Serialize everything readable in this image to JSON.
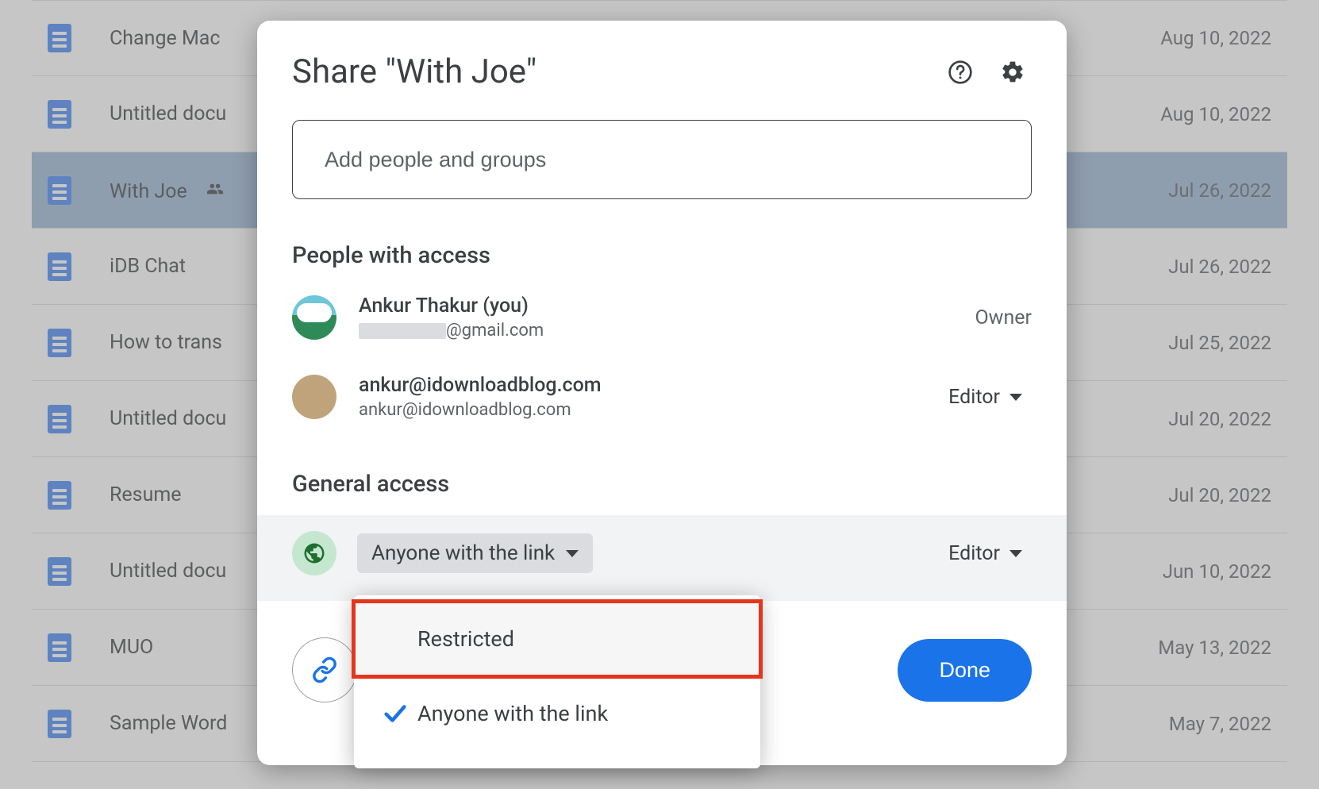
{
  "files": [
    {
      "name": "Change Mac",
      "date": "Aug 10, 2022",
      "shared": false
    },
    {
      "name": "Untitled docu",
      "date": "Aug 10, 2022",
      "shared": false
    },
    {
      "name": "With Joe",
      "date": "Jul 26, 2022",
      "shared": true,
      "selected": true
    },
    {
      "name": "iDB Chat",
      "date": "Jul 26, 2022",
      "shared": false
    },
    {
      "name": "How to trans",
      "date": "Jul 25, 2022",
      "shared": false
    },
    {
      "name": "Untitled docu",
      "date": "Jul 20, 2022",
      "shared": false
    },
    {
      "name": "Resume",
      "date": "Jul 20, 2022",
      "shared": false
    },
    {
      "name": "Untitled docu",
      "date": "Jun 10, 2022",
      "shared": false
    },
    {
      "name": "MUO",
      "date": "May 13, 2022",
      "shared": false
    },
    {
      "name": "Sample Word",
      "date": "May 7, 2022",
      "shared": false
    }
  ],
  "modal": {
    "title": "Share \"With Joe\"",
    "add_placeholder": "Add people and groups",
    "people_heading": "People with access",
    "general_heading": "General access",
    "done": "Done"
  },
  "people": {
    "owner": {
      "name": "Ankur Thakur (you)",
      "email_suffix": "@gmail.com",
      "role": "Owner"
    },
    "editor1": {
      "name": "ankur@idownloadblog.com",
      "email": "ankur@idownloadblog.com",
      "role": "Editor"
    }
  },
  "general": {
    "current": "Anyone with the link",
    "role": "Editor"
  },
  "dropdown": {
    "restricted": "Restricted",
    "anyone": "Anyone with the link"
  }
}
